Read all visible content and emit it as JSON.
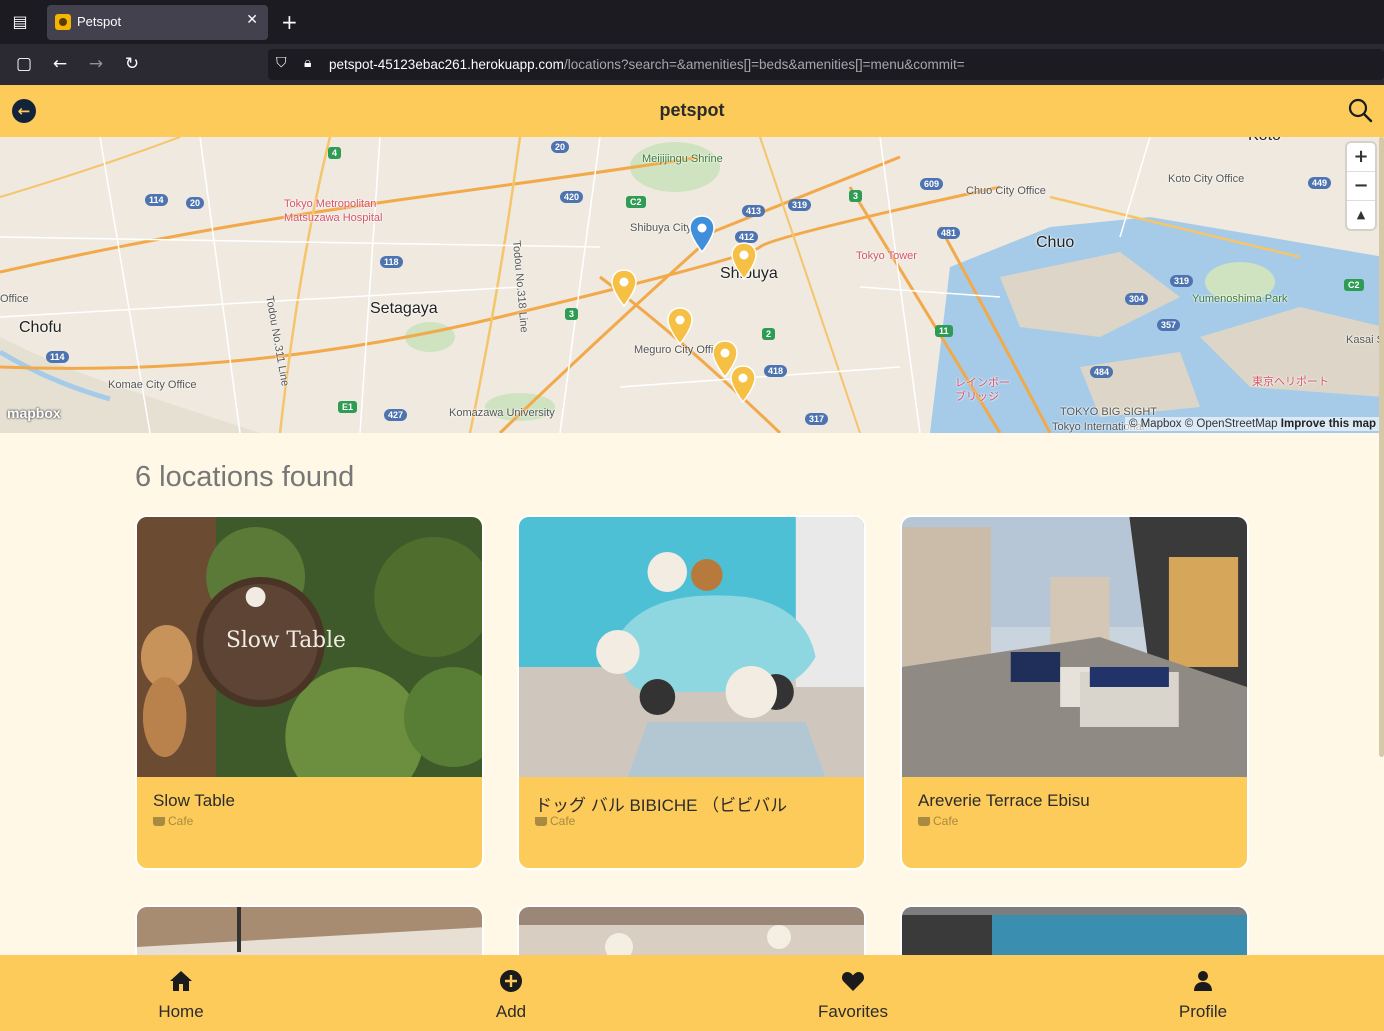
{
  "browser": {
    "tab_title": "Petspot",
    "url_host": "petspot-45123ebac261.herokuapp.com",
    "url_path": "/locations?search=&amenities[]=beds&amenities[]=menu&commit="
  },
  "header": {
    "brand": "petspot"
  },
  "map": {
    "labels": {
      "meiji": "Meijijingu Shrine",
      "shibuya_city": "Shibuya City",
      "shibuya": "Shibuya",
      "setagaya": "Setagaya",
      "chofu": "Chofu",
      "chuo": "Chuo",
      "chuo_office": "Chuo City Office",
      "koto_office": "Koto City Office",
      "meguro_office": "Meguro City Office",
      "komae_office": "Komae City Office",
      "komazawa": "Komazawa University",
      "tokyo_tower": "Tokyo Tower",
      "hospital": "Tokyo Metropolitan Matsuzawa Hospital",
      "todou311": "Todou No.311 Line",
      "todou318": "Todou No.318 Line",
      "yumenoshima": "Yumenoshima Park",
      "rainbow": "レインボー ブリッジ",
      "harbor": "東京ヘリポート",
      "bigsight": "TOKYO BIG SIGHT",
      "intl": "Tokyo International",
      "office": "Office",
      "kasai": "Kasai S",
      "koto": "Koto"
    },
    "zoom_in": "+",
    "zoom_out": "−",
    "compass": "▲",
    "logo": "mapbox",
    "attribution": "© Mapbox © OpenStreetMap",
    "improve": "Improve this map"
  },
  "results": {
    "count_text": "6 locations found",
    "cards": [
      {
        "name": "Slow Table",
        "category": "Cafe"
      },
      {
        "name": "ドッグ バル BIBICHE （ビビバル",
        "category": "Cafe"
      },
      {
        "name": "Areverie Terrace Ebisu",
        "category": "Cafe"
      }
    ]
  },
  "bottom_nav": {
    "home": "Home",
    "add": "Add",
    "favorites": "Favorites",
    "profile": "Profile"
  }
}
